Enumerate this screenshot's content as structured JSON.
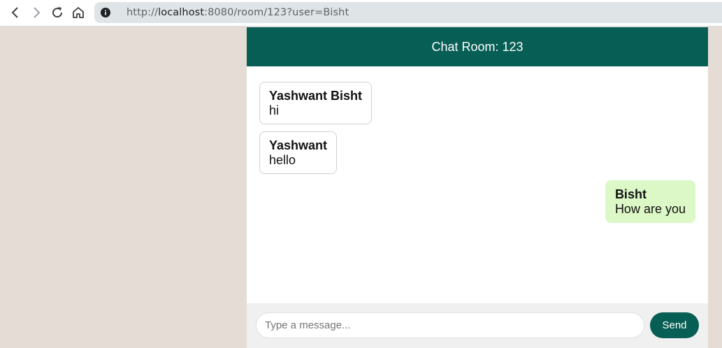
{
  "browser": {
    "url_scheme": "http://",
    "url_host": "localhost",
    "url_rest": ":8080/room/123?user=Bisht",
    "icons": [
      "back-icon",
      "forward-icon",
      "reload-icon",
      "home-icon",
      "info-icon"
    ]
  },
  "chat": {
    "header_title": "Chat Room: 123",
    "messages": [
      {
        "sender": "Yashwant Bisht",
        "text": "hi",
        "direction": "received"
      },
      {
        "sender": "Yashwant",
        "text": "hello",
        "direction": "received"
      },
      {
        "sender": "Bisht",
        "text": "How are you",
        "direction": "sent"
      }
    ],
    "input_placeholder": "Type a message...",
    "input_value": "",
    "send_label": "Send"
  },
  "colors": {
    "header": "#075e54",
    "sent_bubble": "#dcf8c6",
    "page_background": "#e5ddd5",
    "send_button": "#075e54"
  }
}
